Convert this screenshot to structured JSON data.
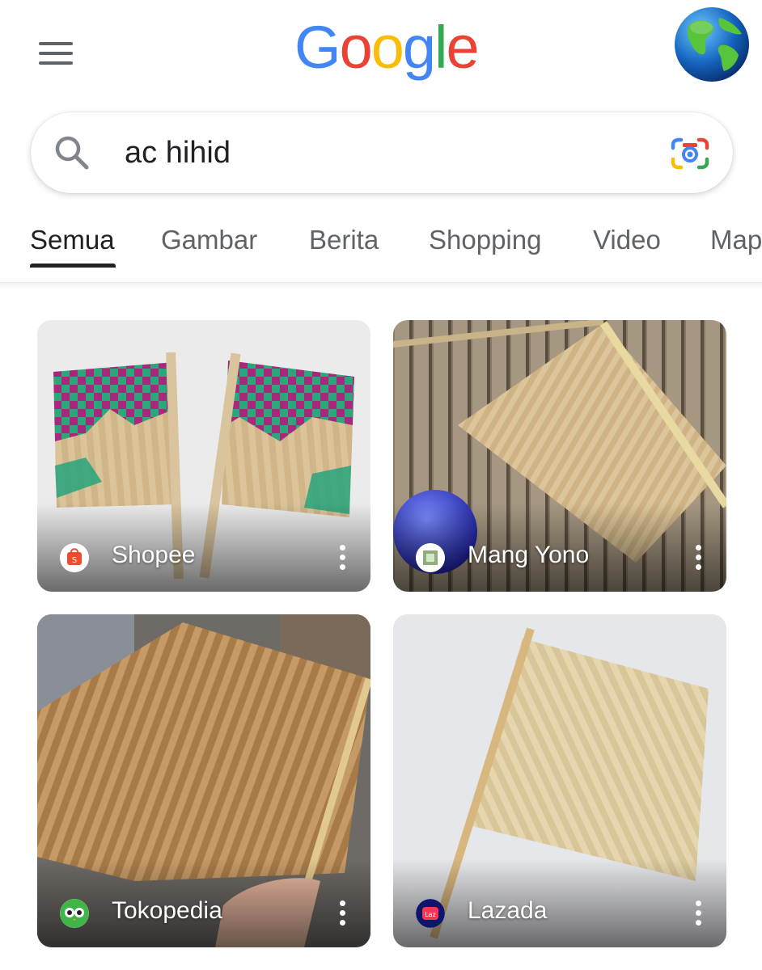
{
  "header": {
    "logo_letters": [
      {
        "ch": "G",
        "color": "#4285F4"
      },
      {
        "ch": "o",
        "color": "#EA4335"
      },
      {
        "ch": "o",
        "color": "#FBBC05"
      },
      {
        "ch": "g",
        "color": "#4285F4"
      },
      {
        "ch": "l",
        "color": "#34A853"
      },
      {
        "ch": "e",
        "color": "#EA4335"
      }
    ],
    "menu_icon": "hamburger-icon",
    "avatar_icon": "globe-icon"
  },
  "search": {
    "query": "ac hihid",
    "search_icon": "search-icon",
    "lens_icon": "google-lens-icon"
  },
  "tabs": [
    {
      "label": "Semua",
      "active": true
    },
    {
      "label": "Gambar",
      "active": false
    },
    {
      "label": "Berita",
      "active": false
    },
    {
      "label": "Shopping",
      "active": false
    },
    {
      "label": "Video",
      "active": false
    },
    {
      "label": "Maps",
      "active": false
    }
  ],
  "results": [
    {
      "source": "Shopee",
      "icon": "shopee-icon",
      "icon_color": "#EE4D2D"
    },
    {
      "source": "Mang Yono",
      "icon": "site-favicon-icon",
      "icon_color": "#6b8e5a"
    },
    {
      "source": "Tokopedia",
      "icon": "tokopedia-icon",
      "icon_color": "#42B549"
    },
    {
      "source": "Lazada",
      "icon": "lazada-icon",
      "icon_color": "#0F146D"
    }
  ],
  "colors": {
    "tab_active": "#202124",
    "tab_inactive": "#5f6368"
  }
}
